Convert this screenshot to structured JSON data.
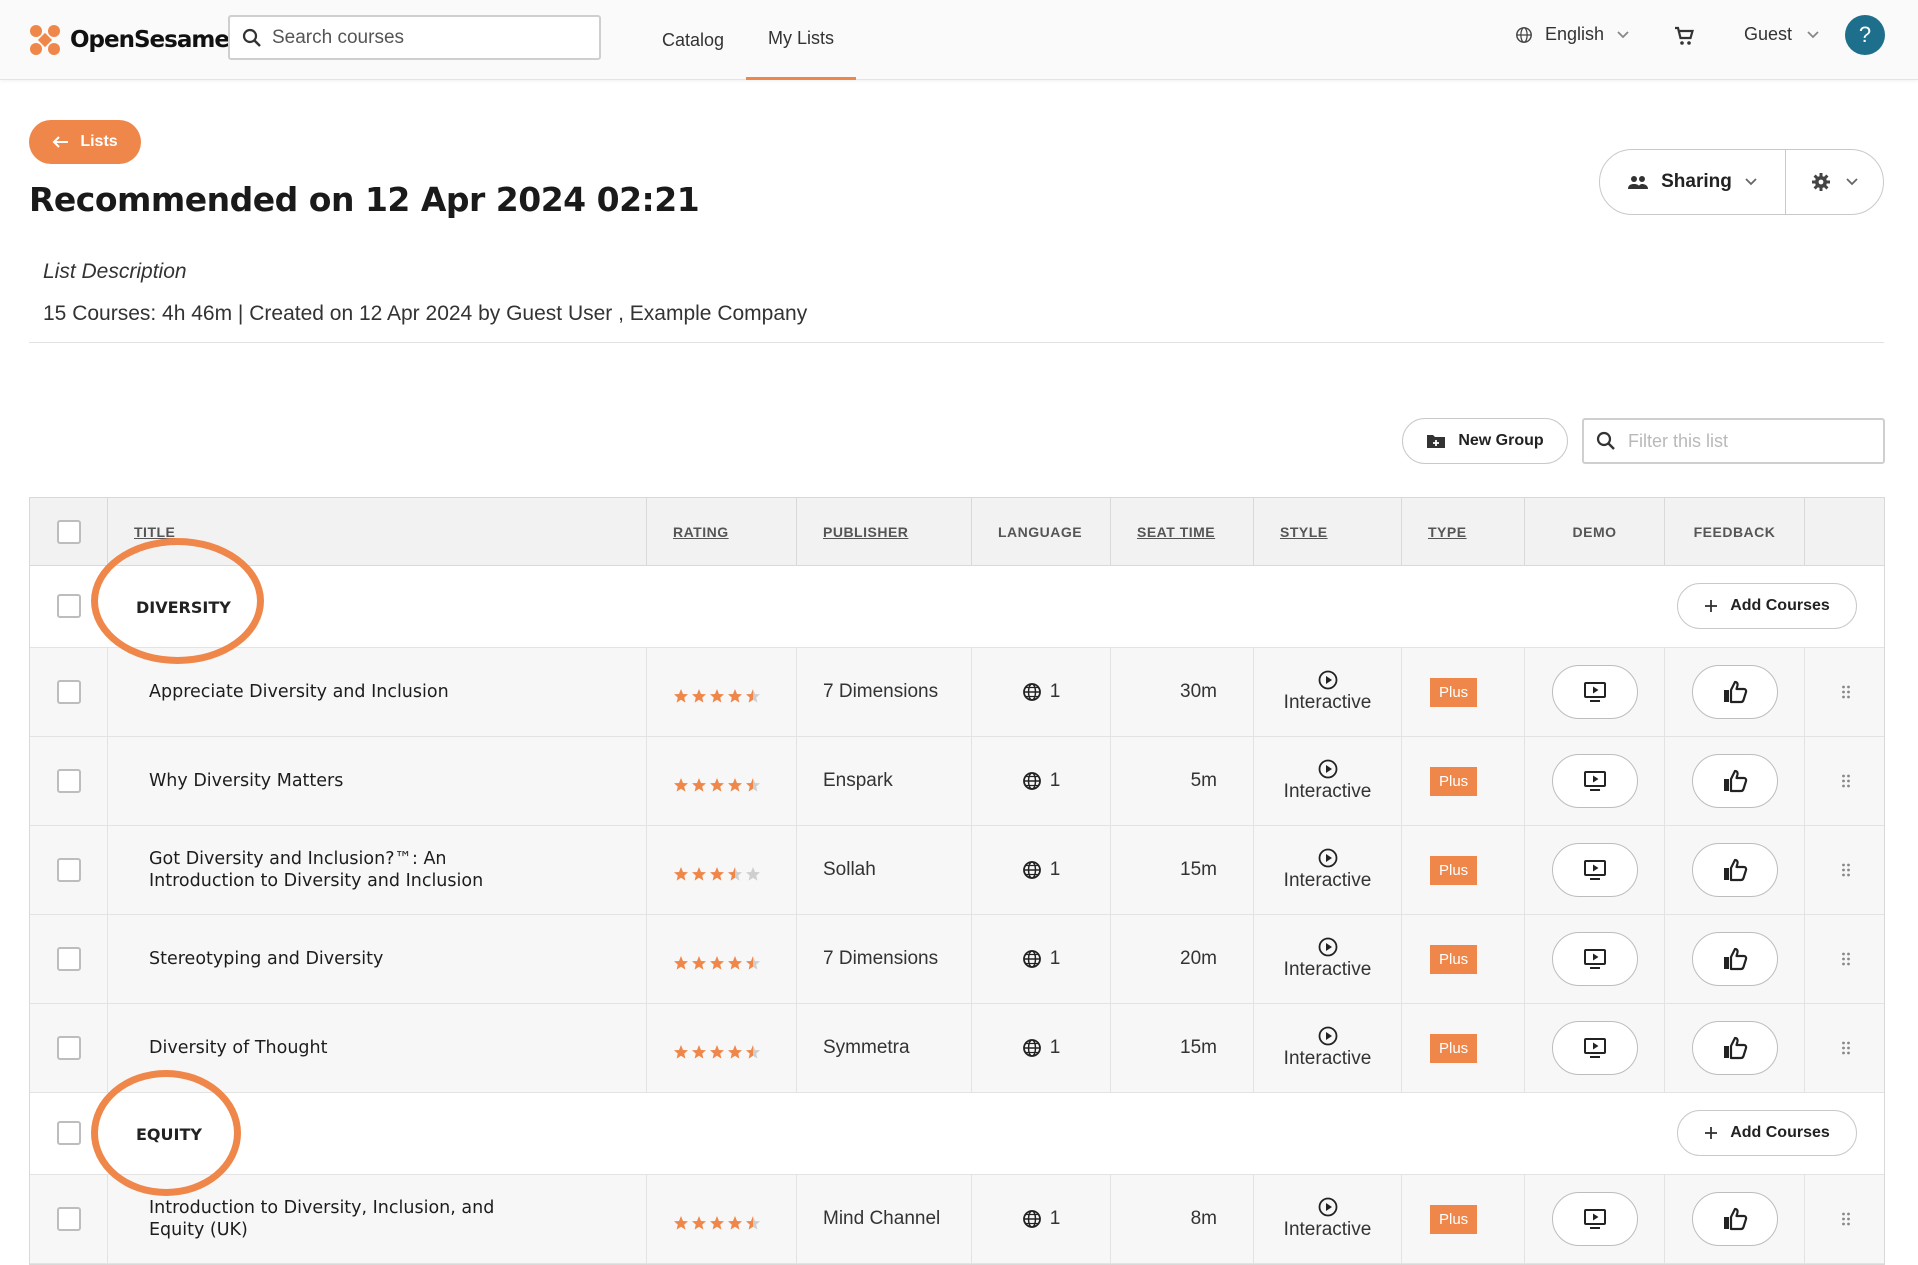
{
  "header": {
    "logo_text": "OpenSesame",
    "search_placeholder": "Search courses",
    "nav": [
      "Catalog",
      "My Lists"
    ],
    "language": "English",
    "user": "Guest",
    "help": "?"
  },
  "page": {
    "back_label": "Lists",
    "title": "Recommended on 12 Apr 2024 02:21",
    "sharing_label": "Sharing",
    "description_label": "List Description",
    "meta": "15 Courses: 4h 46m | Created on 12 Apr 2024 by Guest User , Example Company",
    "new_group_label": "New Group",
    "filter_placeholder": "Filter this list"
  },
  "table": {
    "headers": {
      "title": "TITLE",
      "rating": "RATING",
      "publisher": "PUBLISHER",
      "language": "LANGUAGE",
      "seat_time": "SEAT TIME",
      "style": "STYLE",
      "type": "TYPE",
      "demo": "DEMO",
      "feedback": "FEEDBACK"
    },
    "add_courses_label": "Add Courses",
    "groups": [
      {
        "name": "DIVERSITY",
        "courses": [
          {
            "title": "Appreciate Diversity and Inclusion",
            "rating": 4.5,
            "publisher": "7 Dimensions",
            "languages": "1",
            "seat_time": "30m",
            "style": "Interactive",
            "type": "Plus"
          },
          {
            "title": "Why Diversity Matters",
            "rating": 4.5,
            "publisher": "Enspark",
            "languages": "1",
            "seat_time": "5m",
            "style": "Interactive",
            "type": "Plus"
          },
          {
            "title": "Got Diversity and Inclusion?™: An Introduction to Diversity and Inclusion",
            "rating": 3.5,
            "publisher": "Sollah",
            "languages": "1",
            "seat_time": "15m",
            "style": "Interactive",
            "type": "Plus"
          },
          {
            "title": "Stereotyping and Diversity",
            "rating": 4.5,
            "publisher": "7 Dimensions",
            "languages": "1",
            "seat_time": "20m",
            "style": "Interactive",
            "type": "Plus"
          },
          {
            "title": "Diversity of Thought",
            "rating": 4.5,
            "publisher": "Symmetra",
            "languages": "1",
            "seat_time": "15m",
            "style": "Interactive",
            "type": "Plus"
          }
        ]
      },
      {
        "name": "EQUITY",
        "courses": [
          {
            "title": "Introduction to Diversity, Inclusion, and Equity (UK)",
            "rating": 4.5,
            "publisher": "Mind Channel",
            "languages": "1",
            "seat_time": "8m",
            "style": "Interactive",
            "type": "Plus"
          }
        ]
      }
    ]
  },
  "colors": {
    "accent": "#f0874a",
    "help": "#1d6f8c",
    "star_empty": "#cfcfcf"
  }
}
